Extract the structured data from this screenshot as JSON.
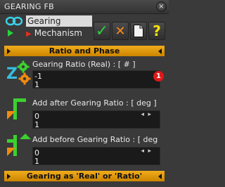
{
  "window": {
    "title": "GEARING FB",
    "close_glyph": "×"
  },
  "tree": {
    "items": [
      {
        "label": "Gearing",
        "icon": "chain-link-icon"
      },
      {
        "label": "Mechanism",
        "icon": "play-triangle-icon"
      }
    ]
  },
  "toolbar": {
    "confirm_glyph": "✓",
    "cancel_glyph": "✕",
    "help_glyph": "?"
  },
  "sections": {
    "ratio_and_phase": "Ratio and Phase",
    "gearing_mode": "Gearing as 'Real' or 'Ratio'"
  },
  "params": {
    "gearing_ratio": {
      "label": "Gearing Ratio (Real) : [ # ]",
      "line1": "-1",
      "line2": "1",
      "icon": "gears-icon"
    },
    "add_after": {
      "label": "Add after Gearing Ratio : [ deg ]",
      "line1": "0",
      "line2": "1",
      "icon": "green-orange-shape-icon"
    },
    "add_before": {
      "label": "Add before Gearing Ratio : [ deg",
      "line1": "0",
      "line2": "1",
      "icon": "green-orange-shape-icon"
    }
  },
  "badge": {
    "value": "1"
  },
  "colors": {
    "accent_orange": "#f0a020",
    "confirm_green": "#2ecc40",
    "cancel_orange": "#ff8c1a",
    "help_yellow": "#f7e210",
    "badge_red": "#e01818"
  }
}
